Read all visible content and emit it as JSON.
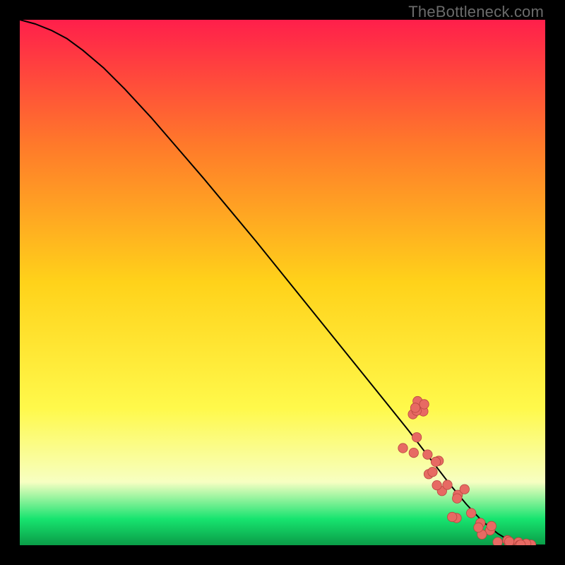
{
  "watermark": "TheBottleneck.com",
  "colors": {
    "bg": "#000000",
    "gradient_top": "#ff1f4b",
    "gradient_upper_mid": "#ff7a2a",
    "gradient_mid": "#ffd21a",
    "gradient_lower_mid": "#fff94b",
    "gradient_pale": "#f7ffc2",
    "gradient_green": "#17e46f",
    "gradient_green_dark": "#0a9c47",
    "curve": "#000000",
    "dot_fill": "#e76a63",
    "dot_stroke": "#b94640"
  },
  "chart_data": {
    "type": "line",
    "title": "",
    "xlabel": "",
    "ylabel": "",
    "xlim": [
      0,
      100
    ],
    "ylim": [
      0,
      100
    ],
    "series": [
      {
        "name": "curve",
        "x": [
          0,
          3,
          6,
          9,
          12,
          16,
          20,
          25,
          30,
          35,
          40,
          45,
          50,
          55,
          60,
          65,
          70,
          74,
          78,
          82,
          85,
          88,
          91,
          93,
          95,
          97,
          98.5,
          100
        ],
        "y": [
          100,
          99.2,
          98.0,
          96.4,
          94.2,
          90.8,
          86.8,
          81.4,
          75.6,
          69.8,
          63.8,
          57.8,
          51.6,
          45.4,
          39.2,
          33.0,
          26.8,
          21.8,
          16.6,
          11.4,
          7.8,
          4.6,
          2.2,
          1.0,
          0.4,
          0.1,
          0.0,
          0.0
        ]
      }
    ],
    "dot_clusters": [
      {
        "x_range": [
          72,
          77
        ],
        "y_range": [
          17,
          28
        ],
        "count": 10
      },
      {
        "x_range": [
          77,
          82
        ],
        "y_range": [
          10,
          18
        ],
        "count": 8
      },
      {
        "x_range": [
          82,
          86
        ],
        "y_range": [
          5,
          11
        ],
        "count": 6
      },
      {
        "x_range": [
          86,
          90
        ],
        "y_range": [
          1.5,
          5
        ],
        "count": 5
      },
      {
        "x_range": [
          90,
          95
        ],
        "y_range": [
          0,
          1.2
        ],
        "count": 6
      },
      {
        "x_range": [
          95,
          100
        ],
        "y_range": [
          0,
          0.3
        ],
        "count": 4
      }
    ],
    "dot_radius_pct": 0.9
  }
}
